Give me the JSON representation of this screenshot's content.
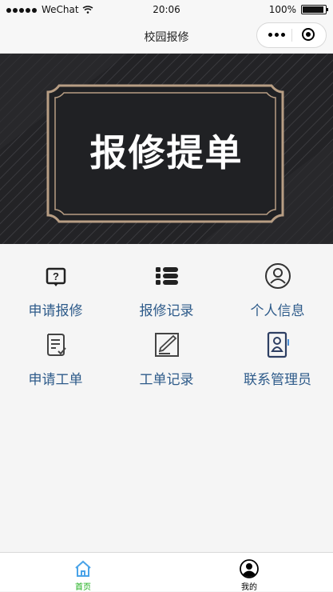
{
  "status_bar": {
    "carrier": "WeChat",
    "time": "20:06",
    "battery_text": "100%",
    "battery_level": 1.0
  },
  "navbar": {
    "title": "校园报修"
  },
  "banner": {
    "title": "报修提单"
  },
  "grid": {
    "items": [
      {
        "label": "申请报修",
        "icon": "question-doc-icon"
      },
      {
        "label": "报修记录",
        "icon": "list-icon"
      },
      {
        "label": "个人信息",
        "icon": "user-circle-icon"
      },
      {
        "label": "申请工单",
        "icon": "checklist-icon"
      },
      {
        "label": "工单记录",
        "icon": "edit-note-icon"
      },
      {
        "label": "联系管理员",
        "icon": "contact-book-icon"
      }
    ]
  },
  "tabbar": {
    "tabs": [
      {
        "label": "首页",
        "icon": "home-icon",
        "active": true,
        "color": "#1aad19"
      },
      {
        "label": "我的",
        "icon": "user-avatar-icon",
        "active": false,
        "color": "#000000"
      }
    ]
  }
}
